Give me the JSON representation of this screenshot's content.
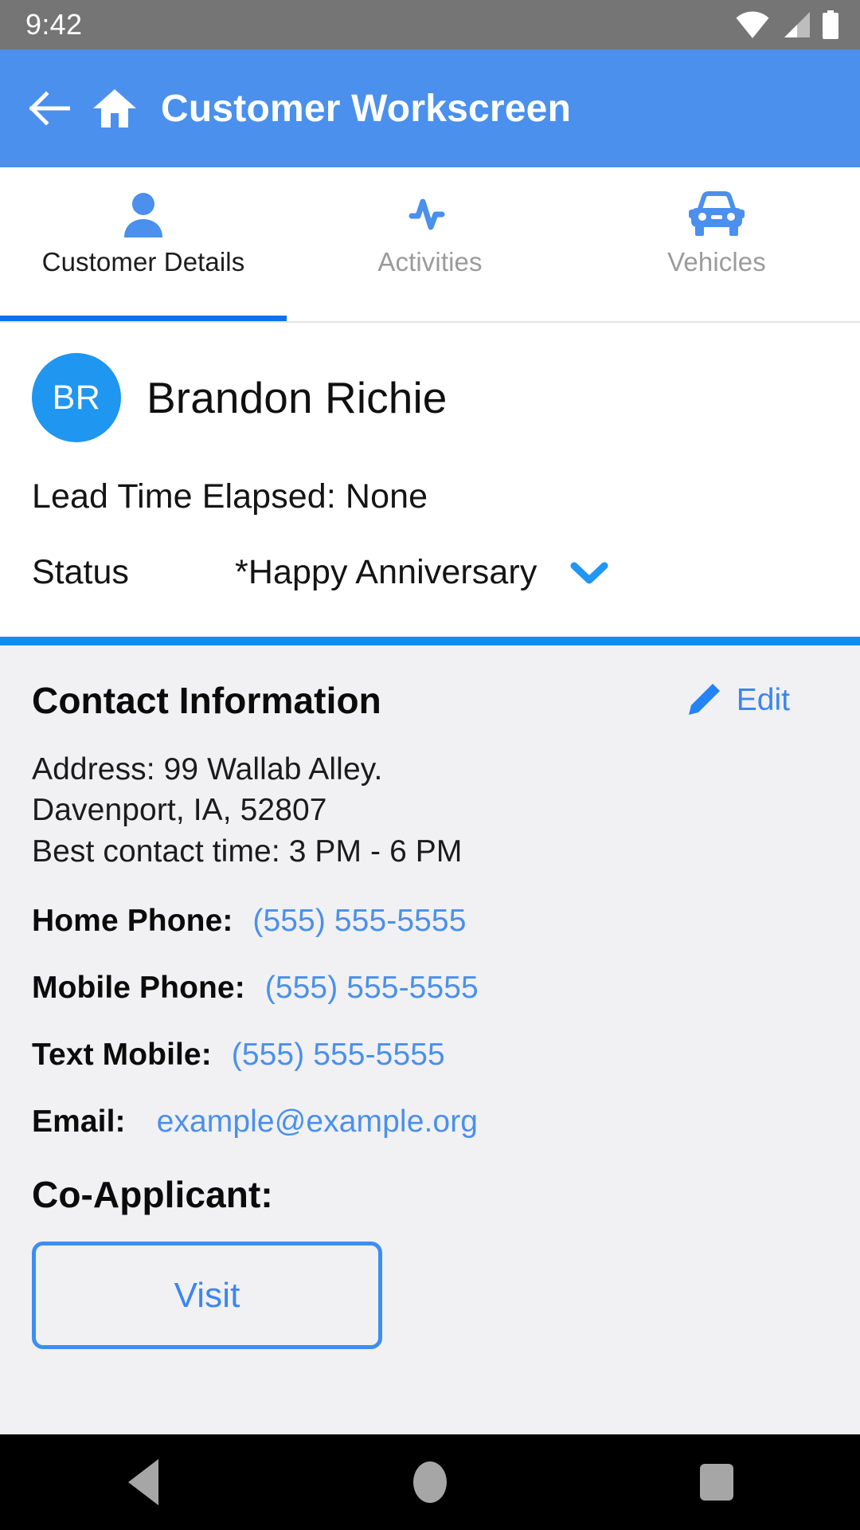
{
  "status_bar": {
    "time": "9:42",
    "icons": [
      "wifi-icon",
      "cellular-signal-icon",
      "battery-icon"
    ]
  },
  "app_bar": {
    "back_icon": "back-arrow-icon",
    "home_icon": "home-icon",
    "title": "Customer Workscreen",
    "background_color": "#4a90ec"
  },
  "tabs": {
    "active_index": 0,
    "indicator_color": "#0a74ef",
    "items": [
      {
        "label": "Customer Details",
        "icon": "person-icon"
      },
      {
        "label": "Activities",
        "icon": "activity-pulse-icon"
      },
      {
        "label": "Vehicles",
        "icon": "car-icon"
      }
    ]
  },
  "customer": {
    "avatar_initials": "BR",
    "avatar_color": "#1f96ef",
    "name": "Brandon Richie",
    "lead_time": "Lead Time Elapsed: None",
    "status_label": "Status",
    "status_value": "*Happy Anniversary",
    "status_dropdown_icon": "chevron-down-icon"
  },
  "divider_color": "#0d8ef5",
  "contact": {
    "title": "Contact Information",
    "edit_label": "Edit",
    "edit_icon": "pencil-icon",
    "address_lines": [
      "Address: 99 Wallab Alley.",
      "Davenport, IA, 52807",
      "Best contact time: 3 PM - 6 PM"
    ],
    "fields": [
      {
        "label": "Home Phone:",
        "value": "(555) 555-5555"
      },
      {
        "label": "Mobile Phone:",
        "value": "(555) 555-5555"
      },
      {
        "label": "Text Mobile:",
        "value": "(555) 555-5555"
      },
      {
        "label": "Email:",
        "value": "example@example.org"
      }
    ],
    "co_applicant_label": "Co-Applicant:",
    "visit_button_label": "Visit",
    "link_color": "#4a90ec",
    "background_color": "#f1f1f3"
  },
  "nav_bar": {
    "back": "nav-back-icon",
    "home": "nav-home-icon",
    "recents": "nav-recents-icon"
  }
}
